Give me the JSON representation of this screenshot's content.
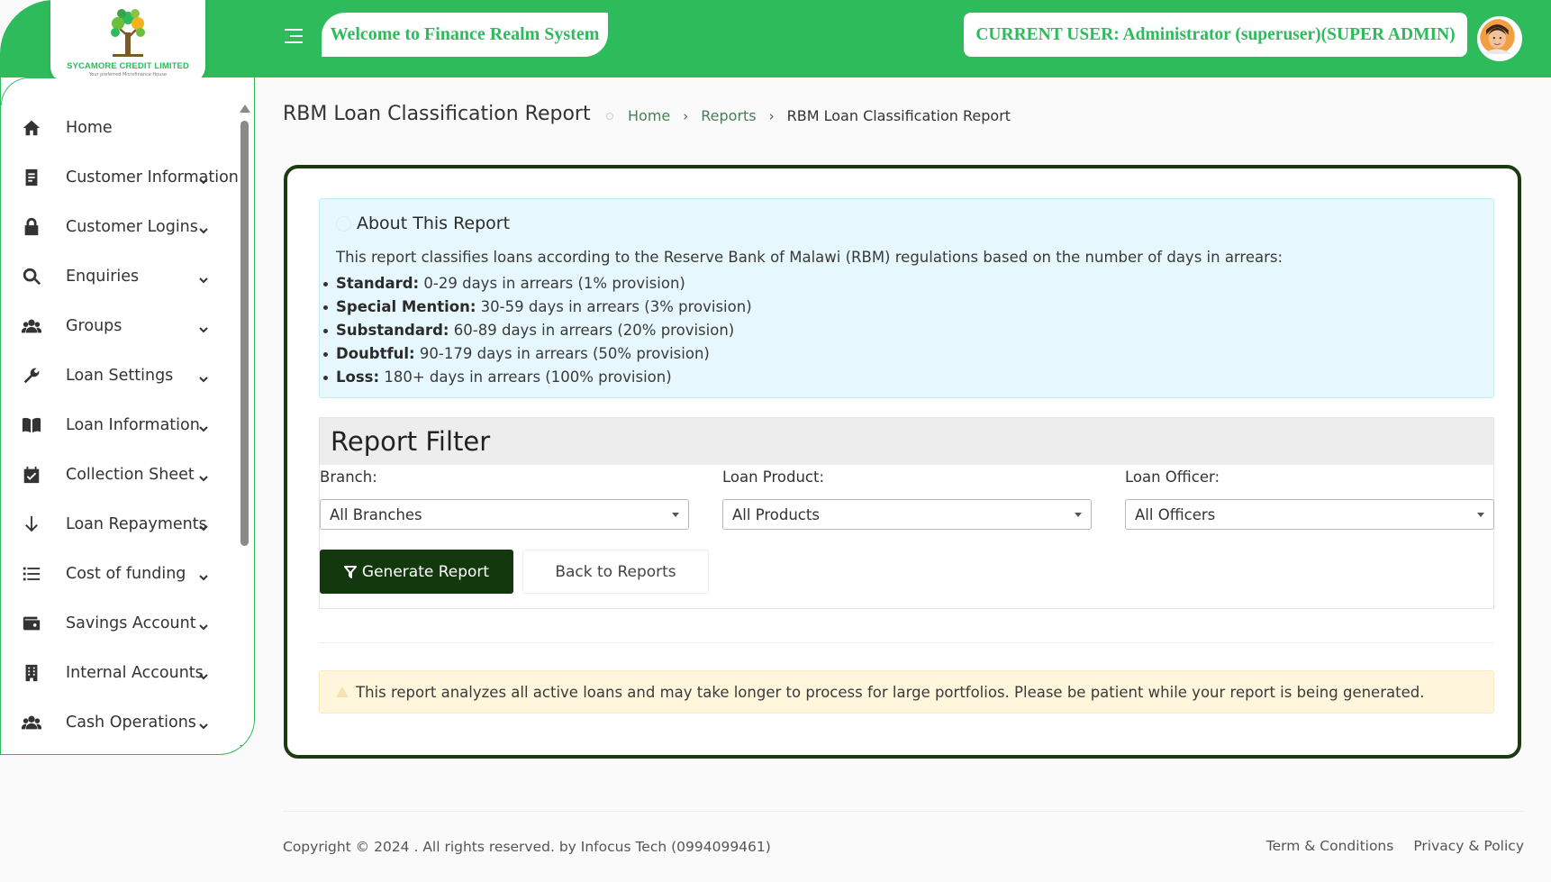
{
  "header": {
    "logo_title": "SYCAMORE CREDIT LIMITED",
    "logo_tagline": "Your preferred Microfinance House",
    "welcome": "Welcome to Finance Realm System",
    "current_user": "CURRENT USER: Administrator (superuser)(SUPER ADMIN)",
    "accent_color": "#2dbb5c"
  },
  "sidebar": {
    "items": [
      {
        "label": "Home",
        "icon": "home-icon",
        "has_chevron": false
      },
      {
        "label": "Customer Information",
        "icon": "document-icon",
        "has_chevron": true
      },
      {
        "label": "Customer Logins",
        "icon": "lock-icon",
        "has_chevron": true
      },
      {
        "label": "Enquiries",
        "icon": "search-icon",
        "has_chevron": true
      },
      {
        "label": "Groups",
        "icon": "users-icon",
        "has_chevron": true
      },
      {
        "label": "Loan Settings",
        "icon": "wrench-icon",
        "has_chevron": true
      },
      {
        "label": "Loan Information",
        "icon": "book-icon",
        "has_chevron": true
      },
      {
        "label": "Collection Sheet",
        "icon": "calendar-check-icon",
        "has_chevron": true
      },
      {
        "label": "Loan Repayments",
        "icon": "arrow-down-icon",
        "has_chevron": true
      },
      {
        "label": "Cost of funding",
        "icon": "list-icon",
        "has_chevron": true
      },
      {
        "label": "Savings Account",
        "icon": "wallet-icon",
        "has_chevron": true
      },
      {
        "label": "Internal Accounts",
        "icon": "building-icon",
        "has_chevron": true
      },
      {
        "label": "Cash Operations",
        "icon": "users-icon",
        "has_chevron": true
      }
    ]
  },
  "page": {
    "title": "RBM Loan Classification Report",
    "breadcrumb": {
      "home": "Home",
      "reports": "Reports",
      "current": "RBM Loan Classification Report"
    }
  },
  "about": {
    "title": "About This Report",
    "intro": "This report classifies loans according to the Reserve Bank of Malawi (RBM) regulations based on the number of days in arrears:",
    "items": [
      {
        "term": "Standard:",
        "desc": " 0-29 days in arrears (1% provision)"
      },
      {
        "term": "Special Mention:",
        "desc": " 30-59 days in arrears (3% provision)"
      },
      {
        "term": "Substandard:",
        "desc": " 60-89 days in arrears (20% provision)"
      },
      {
        "term": "Doubtful:",
        "desc": " 90-179 days in arrears (50% provision)"
      },
      {
        "term": "Loss:",
        "desc": " 180+ days in arrears (100% provision)"
      }
    ]
  },
  "filter": {
    "title": "Report Filter",
    "branch_label": "Branch:",
    "branch_value": "All Branches",
    "product_label": "Loan Product:",
    "product_value": "All Products",
    "officer_label": "Loan Officer:",
    "officer_value": "All Officers",
    "generate_label": "Generate Report",
    "back_label": "Back to Reports"
  },
  "warning": {
    "text": "This report analyzes all active loans and may take longer to process for large portfolios. Please be patient while your report is being generated."
  },
  "footer": {
    "copyright": "Copyright © 2024 . All rights reserved. by Infocus Tech (0994099461)",
    "terms": "Term & Conditions",
    "privacy": "Privacy & Policy"
  }
}
